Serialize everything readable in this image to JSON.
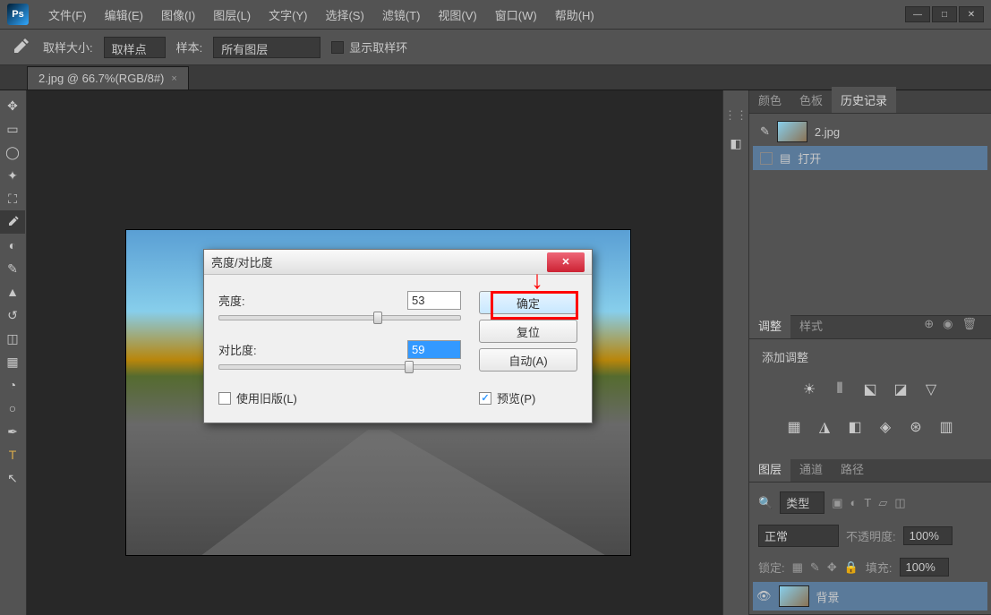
{
  "logo": "Ps",
  "menu": [
    "文件(F)",
    "编辑(E)",
    "图像(I)",
    "图层(L)",
    "文字(Y)",
    "选择(S)",
    "滤镜(T)",
    "视图(V)",
    "窗口(W)",
    "帮助(H)"
  ],
  "options": {
    "sample_label": "取样大小:",
    "sample_value": "取样点",
    "sample2_label": "样本:",
    "sample2_value": "所有图层",
    "ring_label": "显示取样环"
  },
  "tab": {
    "title": "2.jpg @ 66.7%(RGB/8#)",
    "close": "×"
  },
  "dialog": {
    "title": "亮度/对比度",
    "brightness_label": "亮度:",
    "brightness_value": "53",
    "contrast_label": "对比度:",
    "contrast_value": "59",
    "legacy_label": "使用旧版(L)",
    "preview_label": "预览(P)",
    "ok": "确定",
    "reset": "复位",
    "auto": "自动(A)",
    "close": "✕"
  },
  "panels": {
    "history_tabs": [
      "颜色",
      "色板",
      "历史记录"
    ],
    "file_name": "2.jpg",
    "open_label": "打开",
    "adjust_tabs": [
      "调整",
      "样式"
    ],
    "adjust_add": "添加调整",
    "layers_tabs": [
      "图层",
      "通道",
      "路径"
    ],
    "layer_type": "类型",
    "blend_mode": "正常",
    "opacity_label": "不透明度:",
    "opacity_value": "100%",
    "lock_label": "锁定:",
    "fill_label": "填充:",
    "fill_value": "100%",
    "bg_layer": "背景"
  }
}
